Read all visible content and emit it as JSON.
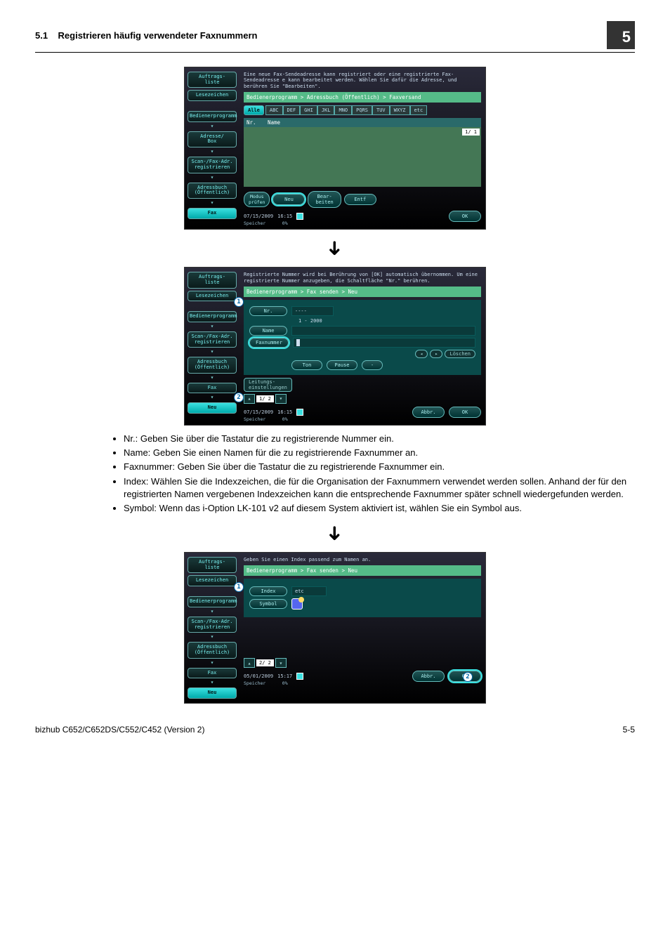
{
  "header": {
    "section_no": "5.1",
    "section_title": "Registrieren häufig verwendeter Faxnummern",
    "chapter": "5"
  },
  "screen1": {
    "side": {
      "auftrags": "Auftrags-\nliste",
      "lesez": "Lesezeichen",
      "bediener": "Bedienerprogramm",
      "adresse": "Adresse/\nBox",
      "scan": "Scan-/Fax-Adr.\nregistrieren",
      "adressbuch": "Adressbuch\n(Öffentlich)",
      "fax": "Fax"
    },
    "instr": "Eine neue Fax-Sendeadresse kann registriert oder eine registrierte Fax-Sendeadresse e kann bearbeitet werden. Wählen Sie dafür die Adresse, und berühren Sie \"Bearbeiten\".",
    "crumb": "Bedienerprogramm > Adressbuch (Öffentlich) > Faxversand",
    "tabs": [
      "Alle",
      "ABC",
      "DEF",
      "GHI",
      "JKL",
      "MNO",
      "PQRS",
      "TUV",
      "WXYZ",
      "etc"
    ],
    "listhead_nr": "Nr.",
    "listhead_name": "Name",
    "pageind": "1/ 1",
    "btns": {
      "modus": "Modus\nprüfen",
      "neu": "Neu",
      "bearb": "Bear-\nbeiten",
      "entf": "Entf"
    },
    "status": {
      "date": "07/15/2009",
      "time": "16:15",
      "mem": "Speicher",
      "mempct": "0%",
      "ok": "OK"
    }
  },
  "screen2": {
    "callout1": "1",
    "callout2": "2",
    "side": {
      "auftrags": "Auftrags-\nliste",
      "lesez": "Lesezeichen",
      "bediener": "Bedienerprogramm",
      "scan": "Scan-/Fax-Adr.\nregistrieren",
      "adressbuch": "Adressbuch\n(Öffentlich)",
      "fax": "Fax",
      "neu": "Neu"
    },
    "instr": "Registrierte Nummer wird bei Berührung von [OK] automatisch übernommen. Um eine registrierte Nummer anzugeben, die Schaltfläche \"Nr.\" berühren.",
    "crumb": "Bedienerprogramm > Fax senden > Neu",
    "fields": {
      "nr_label": "Nr.",
      "nr_value": "----",
      "nr_range": "1 - 2000",
      "name_label": "Name",
      "fax_label": "Faxnummer",
      "loeschen": "Löschen",
      "ton": "Ton",
      "pause": "Pause",
      "dash": "-",
      "leitung": "Leitungs-\neinstellungen",
      "pager": "1/ 2"
    },
    "status": {
      "date": "07/15/2009",
      "time": "16:15",
      "mem": "Speicher",
      "mempct": "0%",
      "abbr": "Abbr.",
      "ok": "OK"
    }
  },
  "bullets": {
    "b1": "Nr.: Geben Sie über die Tastatur die zu registrierende Nummer ein.",
    "b2": "Name: Geben Sie einen Namen für die zu registrierende Faxnummer an.",
    "b3": "Faxnummer: Geben Sie über die Tastatur die zu registrierende Faxnummer ein.",
    "b4": "Index: Wählen Sie die Indexzeichen, die für die Organisation der Faxnummern verwendet werden sollen. Anhand der für den registrierten Namen vergebenen Indexzeichen kann die entsprechende Faxnummer später schnell wiedergefunden werden.",
    "b5": "Symbol: Wenn das i-Option LK-101 v2 auf diesem System aktiviert ist, wählen Sie ein Symbol aus."
  },
  "screen3": {
    "callout1": "1",
    "callout2": "2",
    "side": {
      "auftrags": "Auftrags-\nliste",
      "lesez": "Lesezeichen",
      "bediener": "Bedienerprogramm",
      "scan": "Scan-/Fax-Adr.\nregistrieren",
      "adressbuch": "Adressbuch\n(Öffentlich)",
      "fax": "Fax",
      "neu": "Neu"
    },
    "instr": "Geben Sie einen Index passend zum Namen an.",
    "crumb": "Bedienerprogramm > Fax senden > Neu",
    "fields": {
      "index": "Index",
      "etc": "etc",
      "symbol": "Symbol",
      "pager": "2/ 2"
    },
    "status": {
      "date": "05/01/2009",
      "time": "15:17",
      "mem": "Speicher",
      "mempct": "0%",
      "abbr": "Abbr.",
      "ok": "OK"
    }
  },
  "footer": {
    "model": "bizhub C652/C652DS/C552/C452 (Version 2)",
    "page": "5-5"
  }
}
